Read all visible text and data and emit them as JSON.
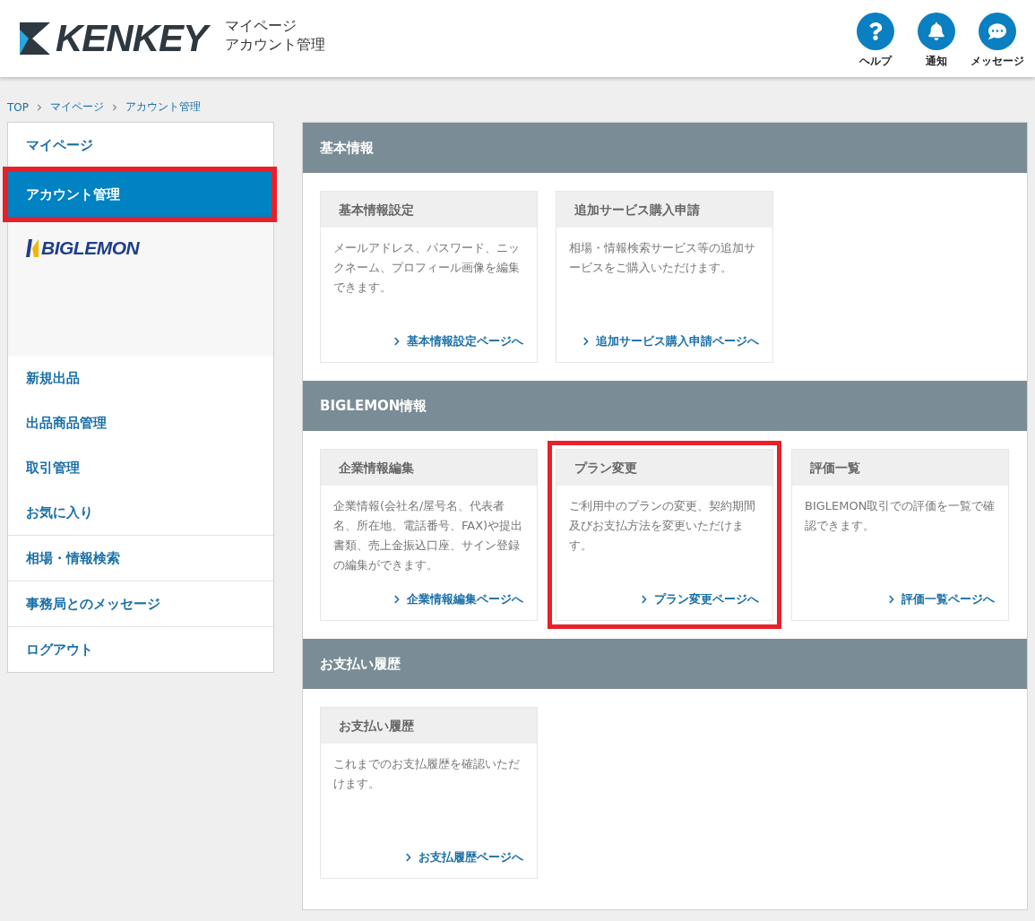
{
  "header": {
    "logo": "KENKEY",
    "title_lines": [
      "マイページ",
      "アカウント管理"
    ],
    "actions": [
      {
        "kind": "help",
        "label": "ヘルプ"
      },
      {
        "kind": "bell",
        "label": "通知"
      },
      {
        "kind": "chat",
        "label": "メッセージ"
      }
    ]
  },
  "breadcrumb": [
    "TOP",
    "マイページ",
    "アカウント管理"
  ],
  "sidebar": {
    "groups": [
      {
        "kind": "links",
        "items": [
          {
            "label": "マイページ",
            "selected": false,
            "highlighted": false
          },
          {
            "label": "アカウント管理",
            "selected": true,
            "highlighted": true
          }
        ]
      },
      {
        "kind": "brand",
        "logo": "BIGLEMON"
      },
      {
        "kind": "links",
        "items": [
          {
            "label": "新規出品",
            "selected": false,
            "highlighted": false
          },
          {
            "label": "出品商品管理",
            "selected": false,
            "highlighted": false
          },
          {
            "label": "取引管理",
            "selected": false,
            "highlighted": false
          },
          {
            "label": "お気に入り",
            "selected": false,
            "highlighted": false
          }
        ]
      },
      {
        "kind": "links",
        "items": [
          {
            "label": "相場・情報検索",
            "selected": false,
            "highlighted": false
          }
        ]
      },
      {
        "kind": "links",
        "items": [
          {
            "label": "事務局とのメッセージ",
            "selected": false,
            "highlighted": false
          }
        ]
      },
      {
        "kind": "links",
        "items": [
          {
            "label": "ログアウト",
            "selected": false,
            "highlighted": false
          }
        ]
      }
    ]
  },
  "sections": [
    {
      "title": "基本情報",
      "cards": [
        {
          "title": "基本情報設定",
          "text": "メールアドレス、パスワード、ニックネーム、プロフィール画像を編集できます。",
          "link": "基本情報設定ページへ",
          "highlighted": false
        },
        {
          "title": "追加サービス購入申請",
          "text": "相場・情報検索サービス等の追加サービスをご購入いただけます。",
          "link": "追加サービス購入申請ページへ",
          "highlighted": false
        }
      ]
    },
    {
      "title": "BIGLEMON情報",
      "cards": [
        {
          "title": "企業情報編集",
          "text": "企業情報(会社名/屋号名、代表者名、所在地、電話番号、FAX)や提出書類、売上金振込口座、サイン登録の編集ができます。",
          "link": "企業情報編集ページへ",
          "highlighted": false
        },
        {
          "title": "プラン変更",
          "text": "ご利用中のプランの変更、契約期間及びお支払方法を変更いただけます。",
          "link": "プラン変更ページへ",
          "highlighted": true
        },
        {
          "title": "評価一覧",
          "text": "BIGLEMON取引での評価を一覧で確認できます。",
          "link": "評価一覧ページへ",
          "highlighted": false
        }
      ]
    },
    {
      "title": "お支払い履歴",
      "cards": [
        {
          "title": "お支払い履歴",
          "text": "これまでのお支払履歴を確認いただけます。",
          "link": "お支払履歴ページへ",
          "highlighted": false
        }
      ]
    }
  ]
}
